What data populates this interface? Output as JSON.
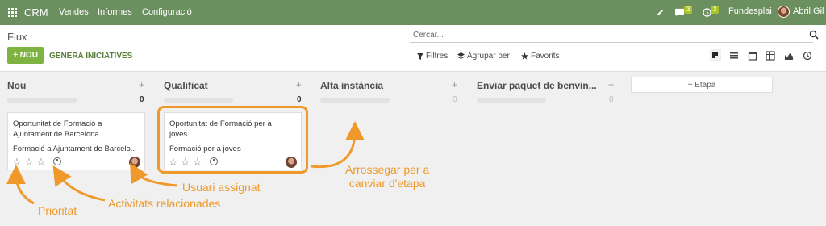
{
  "topbar": {
    "brand": "CRM",
    "menu": [
      "Vendes",
      "Informes",
      "Configuració"
    ],
    "messages_badge": "3",
    "activities_badge": "2",
    "company": "Fundesplai",
    "user": "Abril Gil",
    "bg_color": "#6b8f5f"
  },
  "control": {
    "breadcrumb": "Flux",
    "search_placeholder": "Cercar...",
    "new_label": "+ NOU",
    "generate_label": "GENERA INICIATIVES",
    "filters_label": "Filtres",
    "groupby_label": "Agrupar per",
    "favorites_label": "Favorits",
    "accent_color": "#7fb341"
  },
  "kanban": {
    "columns": [
      {
        "title": "Nou",
        "count": "0"
      },
      {
        "title": "Qualificat",
        "count": "0"
      },
      {
        "title": "Alta instància",
        "count": "0"
      },
      {
        "title": "Enviar paquet de benvin...",
        "count": "0"
      }
    ],
    "add_stage_label": "+ Etapa",
    "cards": [
      {
        "title_line1": "Oportunitat de Formació a",
        "title_line2": "Ajuntament de Barcelona",
        "subtitle": "Formació a Ajuntament de Barcelo..."
      },
      {
        "title_line1": "Oportunitat de Formació per a",
        "title_line2": "joves",
        "subtitle": "Formació per a joves"
      }
    ]
  },
  "annotations": {
    "priority": "Prioritat",
    "activities": "Activitats relacionades",
    "assigned_user": "Usuari assignat",
    "drag_line1": "Arrossegar per a",
    "drag_line2": "canviar d'etapa",
    "color": "#f0992b"
  }
}
